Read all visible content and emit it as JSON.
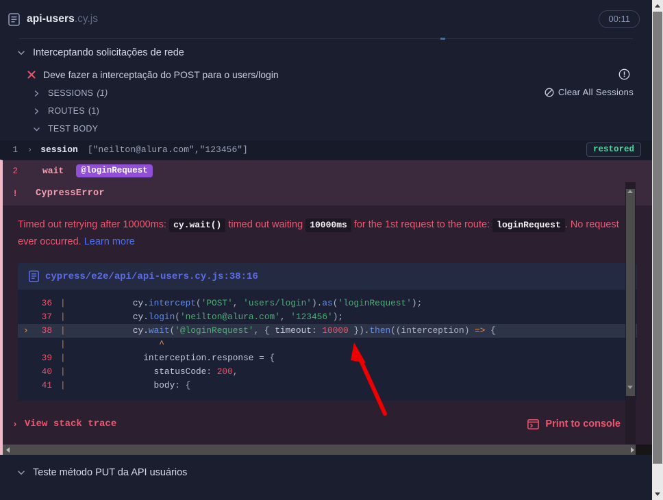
{
  "header": {
    "spec_name": "api-users",
    "spec_ext": ".cy.js",
    "timer": "00:11",
    "file_icon": "file-icon"
  },
  "suite": {
    "title": "Interceptando solicitações de rede",
    "chevron_icon": "chevron-down-icon"
  },
  "test": {
    "title": "Deve fazer a interceptação do POST para o users/login",
    "status_icon": "x-icon",
    "info_icon": "info-circle-icon"
  },
  "sections": [
    {
      "label": "SESSIONS",
      "count": "(1)",
      "italic": true,
      "chevron": "chevron-right-icon"
    },
    {
      "label": "ROUTES",
      "count": "(1)",
      "italic": false,
      "chevron": "chevron-right-icon"
    },
    {
      "label": "TEST BODY",
      "count": "",
      "italic": false,
      "chevron": "chevron-down-icon"
    }
  ],
  "clear_sessions": {
    "label": "Clear All Sessions",
    "icon": "ban-icon"
  },
  "commands": [
    {
      "num": "1",
      "expand": "›",
      "name": "session",
      "args": "[\"neilton@alura.com\",\"123456\"]",
      "badge": "restored"
    },
    {
      "num": "2",
      "name": "wait",
      "alias": "@loginRequest"
    }
  ],
  "error": {
    "marker": "!",
    "name": "CypressError",
    "message_parts": [
      {
        "type": "text",
        "value": "Timed out retrying after 10000ms: "
      },
      {
        "type": "code",
        "value": "cy.wait()"
      },
      {
        "type": "text",
        "value": " timed out waiting "
      },
      {
        "type": "code",
        "value": "10000ms"
      },
      {
        "type": "text",
        "value": " for the 1st request to the route: "
      },
      {
        "type": "code",
        "value": "loginRequest"
      },
      {
        "type": "text",
        "value": ". No request ever occurred. "
      },
      {
        "type": "link",
        "value": "Learn more"
      }
    ],
    "codeframe": {
      "path": "cypress/e2e/api/api-users.cy.js:38:16",
      "path_icon": "file-icon",
      "lines": [
        {
          "num": "36",
          "highlight": false,
          "marker": "",
          "tokens": [
            {
              "t": "plain",
              "v": "            cy."
            },
            {
              "t": "prop",
              "v": "intercept"
            },
            {
              "t": "punc",
              "v": "("
            },
            {
              "t": "str",
              "v": "'POST'"
            },
            {
              "t": "punc",
              "v": ", "
            },
            {
              "t": "str",
              "v": "'users/login'"
            },
            {
              "t": "punc",
              "v": ")."
            },
            {
              "t": "prop",
              "v": "as"
            },
            {
              "t": "punc",
              "v": "("
            },
            {
              "t": "str",
              "v": "'loginRequest'"
            },
            {
              "t": "punc",
              "v": ");"
            }
          ]
        },
        {
          "num": "37",
          "highlight": false,
          "marker": "",
          "tokens": [
            {
              "t": "plain",
              "v": "            cy."
            },
            {
              "t": "prop",
              "v": "login"
            },
            {
              "t": "punc",
              "v": "("
            },
            {
              "t": "str",
              "v": "'neilton@alura.com'"
            },
            {
              "t": "punc",
              "v": ", "
            },
            {
              "t": "str",
              "v": "'123456'"
            },
            {
              "t": "punc",
              "v": ");"
            }
          ]
        },
        {
          "num": "38",
          "highlight": true,
          "marker": "›",
          "tokens": [
            {
              "t": "plain",
              "v": "            cy."
            },
            {
              "t": "prop",
              "v": "wait"
            },
            {
              "t": "punc",
              "v": "("
            },
            {
              "t": "str",
              "v": "'@loginRequest'"
            },
            {
              "t": "punc",
              "v": ", { "
            },
            {
              "t": "key",
              "v": "timeout"
            },
            {
              "t": "punc",
              "v": ": "
            },
            {
              "t": "num",
              "v": "10000"
            },
            {
              "t": "punc",
              "v": " })."
            },
            {
              "t": "prop",
              "v": "then"
            },
            {
              "t": "punc",
              "v": "((interception) "
            },
            {
              "t": "arrow",
              "v": "=>"
            },
            {
              "t": "punc",
              "v": " {"
            }
          ]
        },
        {
          "num": "",
          "highlight": false,
          "marker": "",
          "tokens": [
            {
              "t": "caret",
              "v": "                 ^"
            }
          ]
        },
        {
          "num": "39",
          "highlight": false,
          "marker": "",
          "tokens": [
            {
              "t": "plain",
              "v": "              interception."
            },
            {
              "t": "plain",
              "v": "response "
            },
            {
              "t": "punc",
              "v": "= {"
            }
          ]
        },
        {
          "num": "40",
          "highlight": false,
          "marker": "",
          "tokens": [
            {
              "t": "plain",
              "v": "                statusCode"
            },
            {
              "t": "punc",
              "v": ": "
            },
            {
              "t": "num",
              "v": "200"
            },
            {
              "t": "punc",
              "v": ","
            }
          ]
        },
        {
          "num": "41",
          "highlight": false,
          "marker": "",
          "tokens": [
            {
              "t": "plain",
              "v": "                body"
            },
            {
              "t": "punc",
              "v": ": {"
            }
          ]
        }
      ]
    },
    "stack_trace_label": "View stack trace",
    "stack_trace_icon": "chevron-right-icon",
    "print_console_label": "Print to console",
    "print_console_icon": "console-window-icon"
  },
  "bottom_suite": {
    "title": "Teste método PUT da API usuários",
    "chevron_icon": "chevron-down-icon"
  },
  "colors": {
    "bg": "#1b1e2e",
    "error_bg": "#2c1f30",
    "error_title_bg": "#3b2a3d",
    "error_text": "#f0566f",
    "accent_pink": "#f3b8c5",
    "alias_purple": "#8f4fd6",
    "restored_green": "#4fd6a0",
    "link_blue": "#4d6ff0",
    "annotation_red": "#ee0000"
  }
}
